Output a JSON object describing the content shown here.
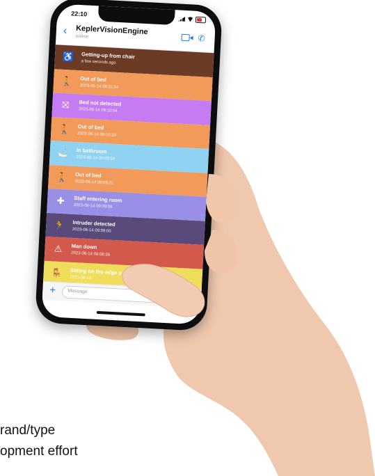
{
  "statusbar": {
    "time": "22:10"
  },
  "chat": {
    "title": "KeplerVisionEngine",
    "subtitle": "online",
    "back_icon": "chevron-left-icon",
    "video_icon": "video-icon",
    "call_icon": "phone-icon"
  },
  "events": [
    {
      "label": "Getting-up from chair",
      "time": "a few seconds ago",
      "color": "#6b3b25",
      "icon": "wheelchair-icon",
      "glyph": "♿"
    },
    {
      "label": "Out of bed",
      "time": "2023-06-14 09:11:24",
      "color": "#f29a5a",
      "icon": "walking-person-icon",
      "glyph": "🚶"
    },
    {
      "label": "Bed not detected",
      "time": "2023-06-14 09:10:54",
      "color": "#c57bf2",
      "icon": "no-bed-icon",
      "glyph": "⛝"
    },
    {
      "label": "Out of bed",
      "time": "2023-06-14 09:10:20",
      "color": "#f29a5a",
      "icon": "walking-person-icon",
      "glyph": "🚶"
    },
    {
      "label": "In bathroom",
      "time": "2023-06-14 09:09:54",
      "color": "#8fd2f2",
      "icon": "bathtub-icon",
      "glyph": "🛁"
    },
    {
      "label": "Out of bed",
      "time": "2023-06-14 09:09:21",
      "color": "#f29a5a",
      "icon": "walking-person-icon",
      "glyph": "🚶"
    },
    {
      "label": "Staff entering room",
      "time": "2023-06-14 09:09:06",
      "color": "#9a8fe6",
      "icon": "medical-cross-icon",
      "glyph": "✚"
    },
    {
      "label": "Intruder detected",
      "time": "2023-06-14 09:09:00",
      "color": "#5a4a7c",
      "icon": "intruder-icon",
      "glyph": "🏃"
    },
    {
      "label": "Man down",
      "time": "2023-06-14 09:08:36",
      "color": "#d4594d",
      "icon": "warning-icon",
      "glyph": "⚠"
    },
    {
      "label": "Sitting on the edge of the bed",
      "time": "2023-06-14",
      "color": "#f0dd5c",
      "icon": "sitting-icon",
      "glyph": "🪑"
    }
  ],
  "input": {
    "placeholder": "Message",
    "add_icon": "plus-icon"
  },
  "caption": {
    "line1": "rand/type",
    "line2": "opment effort"
  }
}
